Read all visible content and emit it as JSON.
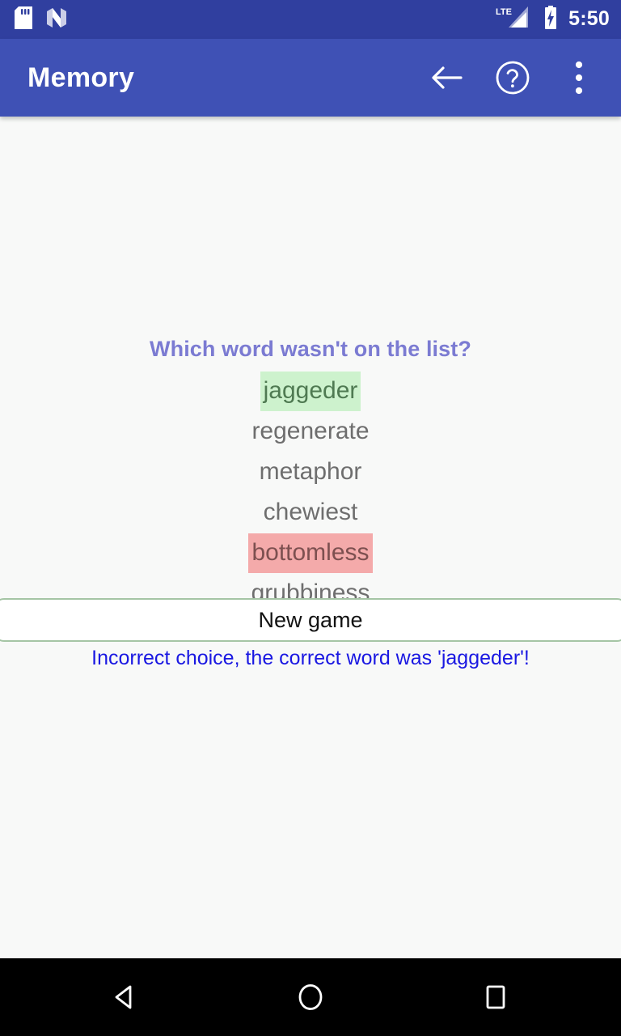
{
  "status_bar": {
    "clock": "5:50",
    "left_icons": [
      "sd-card-icon",
      "android-nougat-icon"
    ],
    "right_icons": [
      "lte-signal-icon",
      "battery-charging-icon"
    ],
    "network_label": "LTE",
    "background_color": "#303f9f"
  },
  "app_bar": {
    "title": "Memory",
    "background_color": "#3f51b5",
    "actions": [
      {
        "name": "back-arrow-icon",
        "label": "Back"
      },
      {
        "name": "help-icon",
        "label": "Help"
      },
      {
        "name": "overflow-menu-icon",
        "label": "More options"
      }
    ]
  },
  "quiz": {
    "question": "Which word wasn't on the list?",
    "question_color": "#7b7bd2",
    "words": [
      {
        "text": "jaggeder",
        "state": "correct"
      },
      {
        "text": "regenerate",
        "state": "neutral"
      },
      {
        "text": "metaphor",
        "state": "neutral"
      },
      {
        "text": "chewiest",
        "state": "neutral"
      },
      {
        "text": "bottomless",
        "state": "wrong"
      },
      {
        "text": "grubbiness",
        "state": "neutral"
      }
    ],
    "feedback": "Incorrect choice, the correct word was 'jaggeder'!",
    "feedback_color": "#1a18e2",
    "correct_highlight_color": "#cdf2cd",
    "wrong_highlight_color": "#f4aaaa",
    "word_color": "#6e6e6e"
  },
  "new_game_button": {
    "label": "New game",
    "border_color": "#a5c5a5",
    "background_color": "#ffffff"
  },
  "nav_bar": {
    "buttons": [
      {
        "name": "nav-back-icon",
        "label": "Back"
      },
      {
        "name": "nav-home-icon",
        "label": "Home"
      },
      {
        "name": "nav-recents-icon",
        "label": "Recents"
      }
    ],
    "background_color": "#000000"
  }
}
